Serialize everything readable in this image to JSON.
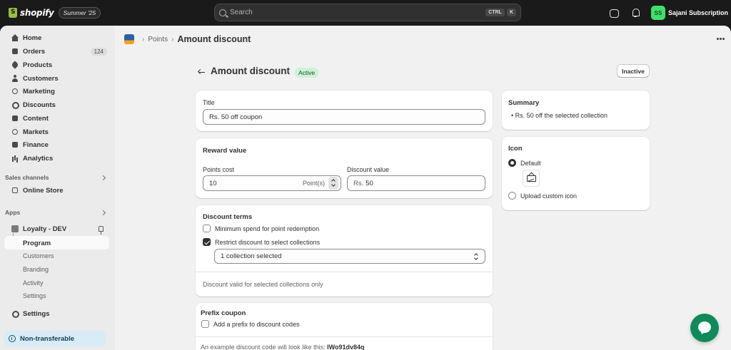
{
  "topbar": {
    "logo_text": "shopify",
    "edition": "Summer '25",
    "search_placeholder": "Search",
    "kbd_ctrl": "CTRL",
    "kbd_k": "K",
    "user_initials": "SS",
    "user_name": "Sajani Subscription"
  },
  "sidebar": {
    "items": [
      {
        "label": "Home"
      },
      {
        "label": "Orders",
        "count": "124"
      },
      {
        "label": "Products"
      },
      {
        "label": "Customers"
      },
      {
        "label": "Marketing"
      },
      {
        "label": "Discounts"
      },
      {
        "label": "Content"
      },
      {
        "label": "Markets"
      },
      {
        "label": "Finance"
      },
      {
        "label": "Analytics"
      }
    ],
    "sales_channels_label": "Sales channels",
    "online_store": "Online Store",
    "apps_label": "Apps",
    "app_name": "Loyalty - DEV",
    "app_sub": [
      "Program",
      "Customers",
      "Branding",
      "Activity",
      "Settings"
    ],
    "settings": "Settings",
    "non_transferable": "Non-transferable"
  },
  "breadcrumb": {
    "link": "Points",
    "current": "Amount discount"
  },
  "page": {
    "title": "Amount discount",
    "status": "Active",
    "inactive_button": "Inactive"
  },
  "title_card": {
    "label": "Title",
    "value": "Rs. 50 off coupon"
  },
  "reward_card": {
    "title": "Reward value",
    "points_label": "Points cost",
    "points_value": "10",
    "points_suffix": "Point(s)",
    "discount_label": "Discount value",
    "discount_prefix": "Rs.",
    "discount_value": "50"
  },
  "terms_card": {
    "title": "Discount terms",
    "min_spend": "Minimum spend for point redemption",
    "min_spend_checked": false,
    "restrict": "Restrict discount to select collections",
    "restrict_checked": true,
    "collection_select": "1 collection selected",
    "note": "Discount valid for selected collections only"
  },
  "prefix_card": {
    "title": "Prefix coupon",
    "add_prefix": "Add a prefix to discount codes",
    "example": "An example discount code will look like this:",
    "example_code": "IWo91dv84q"
  },
  "summary_card": {
    "title": "Summary",
    "bullet": "Rs. 50 off the selected collection"
  },
  "icon_card": {
    "title": "Icon",
    "default": "Default",
    "upload": "Upload custom icon"
  }
}
